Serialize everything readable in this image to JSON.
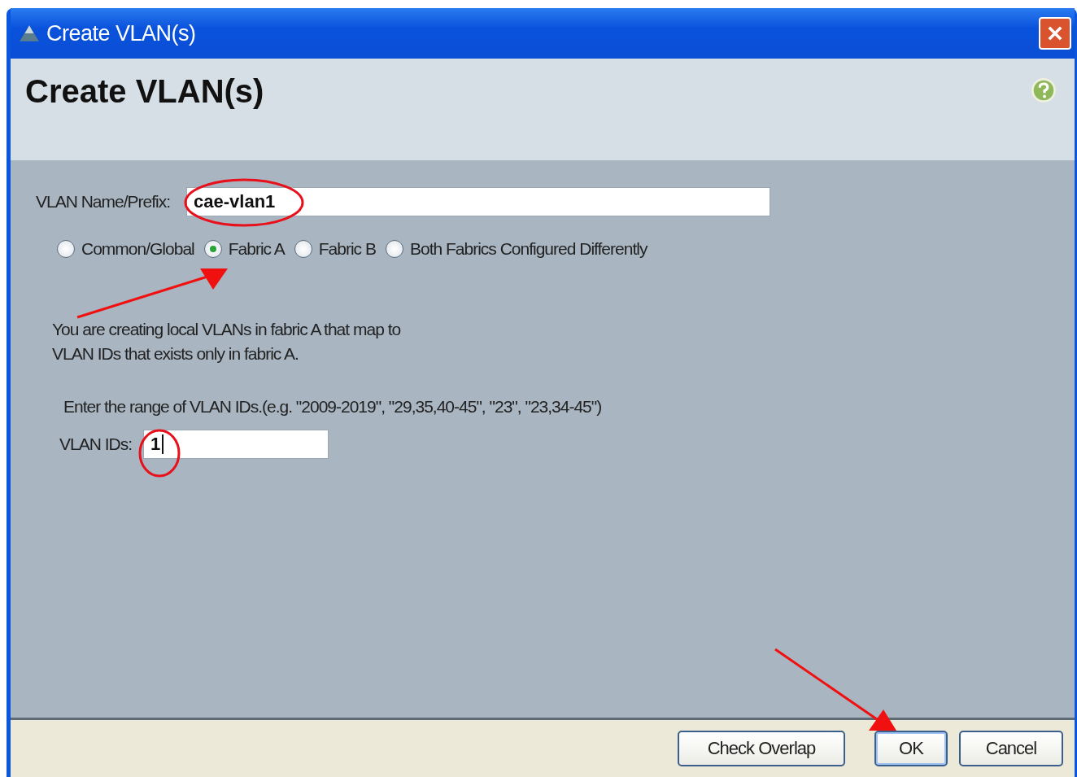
{
  "window": {
    "title": "Create VLAN(s)"
  },
  "header": {
    "title": "Create VLAN(s)"
  },
  "name_field": {
    "label": "VLAN Name/Prefix:",
    "value": "cae-vlan1"
  },
  "fabric_options": [
    {
      "label": "Common/Global",
      "selected": false
    },
    {
      "label": "Fabric A",
      "selected": true
    },
    {
      "label": "Fabric B",
      "selected": false
    },
    {
      "label": "Both Fabrics Configured Differently",
      "selected": false
    }
  ],
  "description": [
    "You are creating local VLANs in fabric A that map to",
    "VLAN IDs that exists only in fabric A."
  ],
  "range_hint": "Enter the range of VLAN IDs.(e.g. \"2009-2019\", \"29,35,40-45\", \"23\", \"23,34-45\")",
  "ids_field": {
    "label": "VLAN IDs:",
    "value": "1"
  },
  "buttons": [
    {
      "label": "Check Overlap",
      "default": false
    },
    {
      "label": "OK",
      "default": true
    },
    {
      "label": "Cancel",
      "default": false
    }
  ]
}
